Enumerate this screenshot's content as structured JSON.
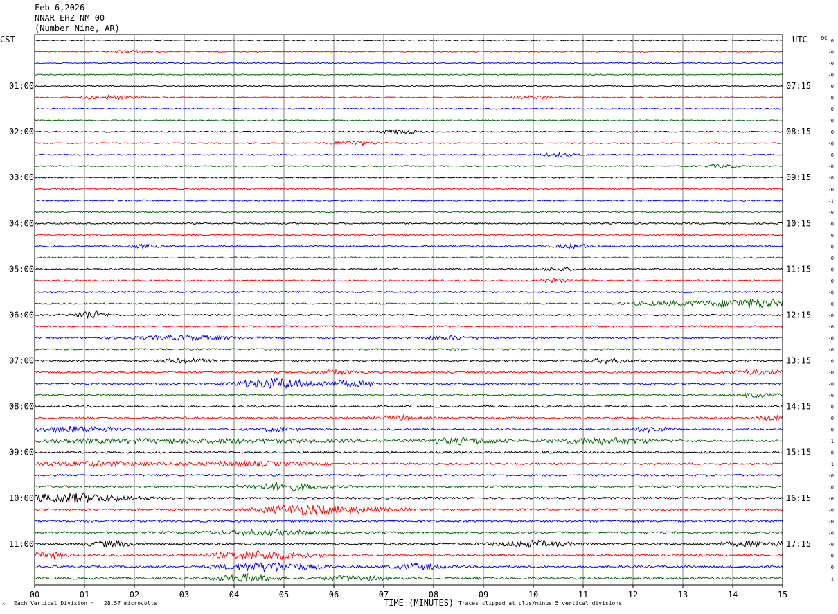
{
  "header": {
    "date": "Feb 6,2026",
    "station": "NNAR EHZ NM 00",
    "location": "(Number Nine, AR)"
  },
  "axes": {
    "left_tz": "CST",
    "right_tz": "UTC",
    "dc_label": "DC",
    "x_title": "TIME (MINUTES)"
  },
  "footer": {
    "scale_text": "Each Vertical Division =   28.57 microvolts",
    "clip_text": "Traces clipped at plus/minus 5 vertical divisions",
    "corner_mark": "^"
  },
  "colors": {
    "cycle": [
      "#000000",
      "#ff0000",
      "#0000ff",
      "#006600"
    ],
    "grid": "#808080"
  },
  "chart_data": {
    "type": "line",
    "title": "NNAR EHZ NM 00",
    "xlabel": "TIME (MINUTES)",
    "xlim": [
      0,
      15
    ],
    "x_ticks": [
      "00",
      "01",
      "02",
      "03",
      "04",
      "05",
      "06",
      "07",
      "08",
      "09",
      "10",
      "11",
      "12",
      "13",
      "14",
      "15"
    ],
    "trace_count": 48,
    "trace_interval_minutes": 15,
    "left_hour_labels": [
      "01:00",
      "02:00",
      "03:00",
      "04:00",
      "05:00",
      "06:00",
      "07:00",
      "08:00",
      "09:00",
      "10:00",
      "11:00"
    ],
    "right_hour_labels": [
      "07:15",
      "08:15",
      "09:15",
      "10:15",
      "11:15",
      "12:15",
      "13:15",
      "14:15",
      "15:15",
      "16:15",
      "17:15"
    ],
    "dc_offsets": [
      "0",
      "-0",
      "-0",
      "-0",
      "0",
      "0",
      "-0",
      "-0",
      "-0",
      "-0",
      "-0",
      "-0",
      "-0",
      "-0",
      "-1",
      "-0",
      "0",
      "0",
      "-0",
      "0",
      "0",
      "0",
      "-0",
      "-0",
      "-0",
      "-0",
      "-0",
      "-0",
      "0",
      "-0",
      "-0",
      "-0",
      "-0",
      "0",
      "-0",
      "-1",
      "0",
      "1",
      "-0",
      "0",
      "-0",
      "-0",
      "-0",
      "-0",
      "-0",
      "-0",
      "0",
      "-1"
    ],
    "events": [
      {
        "trace": 1,
        "minute": 2.0,
        "amp": 2.0,
        "width": 0.5
      },
      {
        "trace": 5,
        "minute": 1.5,
        "amp": 2.5,
        "width": 0.8
      },
      {
        "trace": 5,
        "minute": 10.0,
        "amp": 2.0,
        "width": 0.6
      },
      {
        "trace": 8,
        "minute": 7.3,
        "amp": 3.0,
        "width": 0.5
      },
      {
        "trace": 9,
        "minute": 6.4,
        "amp": 3.0,
        "width": 0.6
      },
      {
        "trace": 10,
        "minute": 10.5,
        "amp": 2.0,
        "width": 0.5
      },
      {
        "trace": 11,
        "minute": 13.8,
        "amp": 2.5,
        "width": 0.4
      },
      {
        "trace": 18,
        "minute": 2.2,
        "amp": 2.0,
        "width": 0.4
      },
      {
        "trace": 18,
        "minute": 10.8,
        "amp": 2.5,
        "width": 0.6
      },
      {
        "trace": 20,
        "minute": 10.5,
        "amp": 2.0,
        "width": 0.5
      },
      {
        "trace": 21,
        "minute": 10.4,
        "amp": 2.5,
        "width": 0.4
      },
      {
        "trace": 23,
        "minute": 14.4,
        "amp": 6.0,
        "width": 1.2
      },
      {
        "trace": 23,
        "minute": 12.8,
        "amp": 2.5,
        "width": 1.2
      },
      {
        "trace": 24,
        "minute": 1.1,
        "amp": 6.0,
        "width": 0.4
      },
      {
        "trace": 26,
        "minute": 3.0,
        "amp": 2.5,
        "width": 1.5
      },
      {
        "trace": 26,
        "minute": 8.3,
        "amp": 2.5,
        "width": 0.8
      },
      {
        "trace": 28,
        "minute": 11.5,
        "amp": 3.0,
        "width": 0.6
      },
      {
        "trace": 28,
        "minute": 3.0,
        "amp": 2.5,
        "width": 0.8
      },
      {
        "trace": 29,
        "minute": 6.0,
        "amp": 2.5,
        "width": 0.6
      },
      {
        "trace": 29,
        "minute": 14.5,
        "amp": 2.5,
        "width": 1.0
      },
      {
        "trace": 30,
        "minute": 4.8,
        "amp": 7.0,
        "width": 1.0
      },
      {
        "trace": 30,
        "minute": 6.3,
        "amp": 3.5,
        "width": 0.8
      },
      {
        "trace": 31,
        "minute": 14.5,
        "amp": 2.5,
        "width": 0.6
      },
      {
        "trace": 33,
        "minute": 7.3,
        "amp": 2.5,
        "width": 0.6
      },
      {
        "trace": 33,
        "minute": 14.8,
        "amp": 3.0,
        "width": 0.4
      },
      {
        "trace": 34,
        "minute": 0.8,
        "amp": 4.0,
        "width": 1.2
      },
      {
        "trace": 34,
        "minute": 4.9,
        "amp": 3.0,
        "width": 0.5
      },
      {
        "trace": 34,
        "minute": 12.4,
        "amp": 3.5,
        "width": 0.5
      },
      {
        "trace": 35,
        "minute": 8.6,
        "amp": 4.0,
        "width": 1.0
      },
      {
        "trace": 35,
        "minute": 11.4,
        "amp": 4.0,
        "width": 1.5
      },
      {
        "trace": 35,
        "minute": 3.0,
        "amp": 2.5,
        "width": 5.0
      },
      {
        "trace": 37,
        "minute": 1.2,
        "amp": 3.0,
        "width": 2.0
      },
      {
        "trace": 37,
        "minute": 4.3,
        "amp": 3.0,
        "width": 1.5
      },
      {
        "trace": 39,
        "minute": 5.0,
        "amp": 4.5,
        "width": 1.0
      },
      {
        "trace": 40,
        "minute": 0.8,
        "amp": 6.0,
        "width": 1.5
      },
      {
        "trace": 41,
        "minute": 5.3,
        "amp": 6.0,
        "width": 1.2
      },
      {
        "trace": 41,
        "minute": 6.5,
        "amp": 3.0,
        "width": 1.2
      },
      {
        "trace": 43,
        "minute": 4.6,
        "amp": 3.0,
        "width": 1.5
      },
      {
        "trace": 44,
        "minute": 1.5,
        "amp": 4.0,
        "width": 0.6
      },
      {
        "trace": 44,
        "minute": 10.0,
        "amp": 4.0,
        "width": 1.0
      },
      {
        "trace": 44,
        "minute": 14.5,
        "amp": 3.0,
        "width": 1.0
      },
      {
        "trace": 45,
        "minute": 4.5,
        "amp": 6.0,
        "width": 1.2
      },
      {
        "trace": 45,
        "minute": 0.2,
        "amp": 4.0,
        "width": 0.6
      },
      {
        "trace": 46,
        "minute": 4.7,
        "amp": 6.0,
        "width": 1.2
      },
      {
        "trace": 46,
        "minute": 7.7,
        "amp": 4.0,
        "width": 0.6
      },
      {
        "trace": 47,
        "minute": 4.2,
        "amp": 5.0,
        "width": 0.8
      },
      {
        "trace": 47,
        "minute": 6.4,
        "amp": 3.0,
        "width": 0.8
      }
    ]
  }
}
